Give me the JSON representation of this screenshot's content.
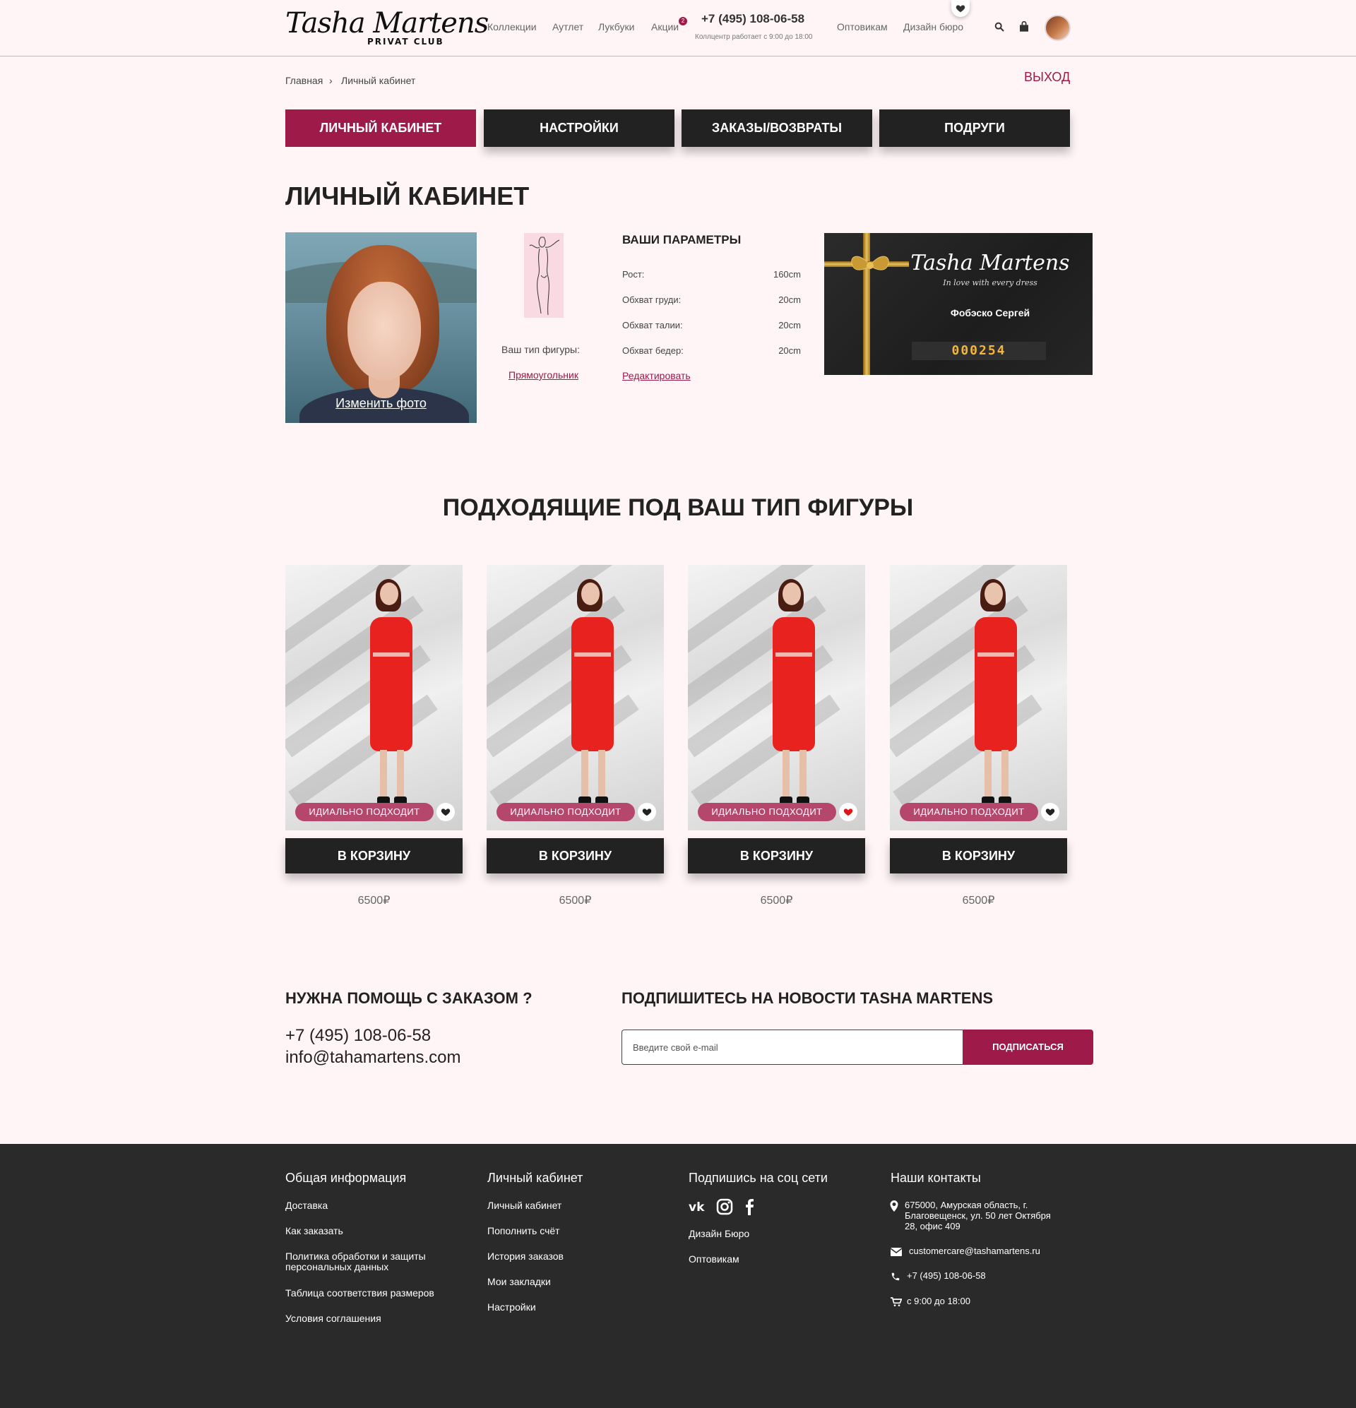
{
  "header": {
    "logo_text": "Tasha Martens",
    "logo_sub": "PRIVAT CLUB",
    "nav": [
      "Коллекции",
      "Аутлет",
      "Лукбуки",
      "Акции",
      "Оптовикам",
      "Дизайн бюро"
    ],
    "promo_badge": "2",
    "phone": "+7 (495) 108-06-58",
    "callcenter": "Коллцентр работает с 9:00 до 18:00",
    "icons": [
      "heart-icon",
      "search-icon",
      "bag-icon",
      "user-avatar"
    ]
  },
  "breadcrumb": {
    "home": "Главная",
    "separator": "›",
    "current": "Личный кабинет"
  },
  "logout_label": "ВЫХОД",
  "tabs": [
    {
      "label": "ЛИЧНЫЙ КАБИНЕТ",
      "active": true
    },
    {
      "label": "НАСТРОЙКИ",
      "active": false
    },
    {
      "label": "ЗАКАЗЫ/ВОЗВРАТЫ",
      "active": false
    },
    {
      "label": "ПОДРУГИ",
      "active": false
    }
  ],
  "page_title": "ЛИЧНЫЙ КАБИНЕТ",
  "profile": {
    "change_photo": "Изменить фото",
    "figure_label": "Ваш тип фигуры:",
    "figure_type": "Прямоугольник"
  },
  "params": {
    "title": "ВАШИ ПАРАМЕТРЫ",
    "rows": [
      {
        "label": "Рост:",
        "value": "160cm"
      },
      {
        "label": "Обхват груди:",
        "value": "20cm"
      },
      {
        "label": "Обхват талии:",
        "value": "20cm"
      },
      {
        "label": "Обхват бедер:",
        "value": "20cm"
      }
    ],
    "edit": "Редактировать"
  },
  "club_card": {
    "brand": "Tasha Martens",
    "tagline": "In love with every dress",
    "holder": "Фобэско Сергей",
    "number": "000254"
  },
  "fit_title": "ПОДХОДЯЩИЕ ПОД ВАШ ТИП ФИГУРЫ",
  "products": [
    {
      "badge": "ИДИАЛЬНО ПОДХОДИТ",
      "cart": "В КОРЗИНУ",
      "price": "6500₽",
      "favorited": false
    },
    {
      "badge": "ИДИАЛЬНО ПОДХОДИТ",
      "cart": "В КОРЗИНУ",
      "price": "6500₽",
      "favorited": false
    },
    {
      "badge": "ИДИАЛЬНО ПОДХОДИТ",
      "cart": "В КОРЗИНУ",
      "price": "6500₽",
      "favorited": true
    },
    {
      "badge": "ИДИАЛЬНО ПОДХОДИТ",
      "cart": "В КОРЗИНУ",
      "price": "6500₽",
      "favorited": false
    }
  ],
  "help": {
    "title": "НУЖНА ПОМОЩЬ С ЗАКАЗОМ ?",
    "phone": "+7 (495) 108-06-58",
    "email": "info@tahamartens.com"
  },
  "subscribe": {
    "title": "ПОДПИШИТЕСЬ НА НОВОСТИ TASHA MARTENS",
    "placeholder": "Введите свой e-mail",
    "button": "ПОДПИСАТЬСЯ"
  },
  "footer": {
    "col1": {
      "title": "Общая информация",
      "links": [
        "Доставка",
        "Как заказать",
        "Политика обработки и защиты",
        "персональных данных",
        "Таблица соответствия размеров",
        "Условия соглашения"
      ]
    },
    "col2": {
      "title": "Личный кабинет",
      "links": [
        "Личный кабинет",
        "Пополнить счёт",
        "История заказов",
        "Мои закладки",
        "Настройки"
      ]
    },
    "col3": {
      "title": "Подпишись на соц сети",
      "social": [
        "vk-icon",
        "instagram-icon",
        "facebook-icon"
      ],
      "links": [
        "Дизайн Бюро",
        "Оптовикам"
      ]
    },
    "col4": {
      "title": "Наши контакты",
      "address": [
        "675000, Амурская область, г.",
        "Благовещенск, ул. 50 лет Октября",
        "28, офис 409"
      ],
      "email": "customercare@tashamartens.ru",
      "phone": "+7 (495) 108-06-58",
      "hours": "с 9:00 до 18:00"
    }
  },
  "colors": {
    "accent": "#9e1a48",
    "dark": "#222222",
    "background": "#fff5f7",
    "footer": "#2a2a2a",
    "badge": "#b5476c"
  }
}
